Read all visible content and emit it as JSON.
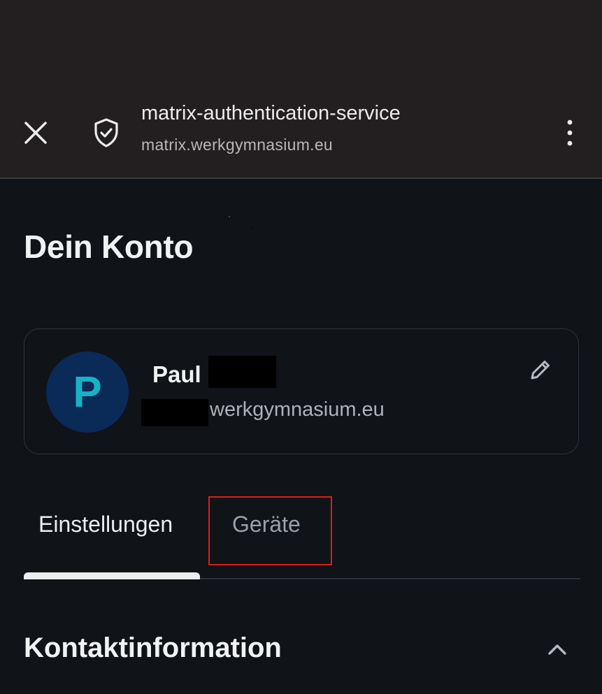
{
  "browser": {
    "site_title": "matrix-authentication-service",
    "site_url": "matrix.werkgymnasium.eu",
    "close_icon": "close-icon",
    "security_icon": "shield-check-icon",
    "menu_icon": "more-vertical-icon"
  },
  "account": {
    "page_title": "Dein Konto",
    "profile": {
      "avatar_initial": "P",
      "display_name": "Paul",
      "user_domain": "werkgymnasium.eu",
      "edit_icon": "pencil-icon"
    },
    "tabs": [
      {
        "label": "Einstellungen",
        "active": true
      },
      {
        "label": "Geräte",
        "active": false
      }
    ],
    "section": {
      "title": "Kontaktinformation",
      "collapse_icon": "chevron-up-icon"
    }
  },
  "colors": {
    "app_bar": "#231f20",
    "background": "#101317",
    "avatar_bg": "#0a2a58",
    "avatar_fg": "#17b2c4",
    "highlight": "#d81e1e"
  }
}
